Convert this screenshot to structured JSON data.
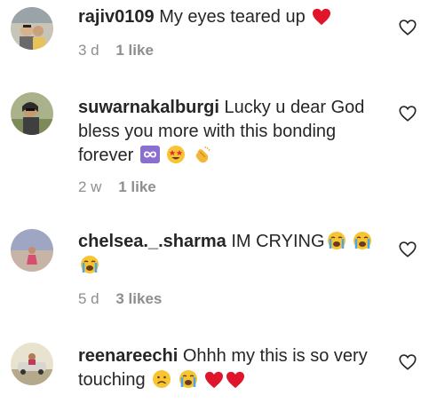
{
  "comments": [
    {
      "username": "rajiv0109",
      "text": "My eyes teared up",
      "emojis": [
        "red-heart"
      ],
      "age": "3 d",
      "likes": "1 like"
    },
    {
      "username": "suwarnakalburgi",
      "text": "Lucky u dear God bless you more with this bonding forever",
      "emojis": [
        "infinity",
        "star-struck",
        "clapping-hands"
      ],
      "age": "2 w",
      "likes": "1 like"
    },
    {
      "username": "chelsea._.sharma",
      "text": "IM CRYING",
      "emojis": [
        "loudly-crying",
        "loudly-crying",
        "loudly-crying"
      ],
      "age": "5 d",
      "likes": "3 likes"
    },
    {
      "username": "reenareechi",
      "text": "Ohhh my this is so very touching",
      "emojis": [
        "sad-face",
        "loudly-crying",
        "red-heart",
        "red-heart"
      ]
    }
  ],
  "colors": {
    "text": "#262626",
    "meta": "#8e8e8e",
    "heart": "#e0245e"
  },
  "icons": {
    "like_button": "heart-outline-icon"
  }
}
